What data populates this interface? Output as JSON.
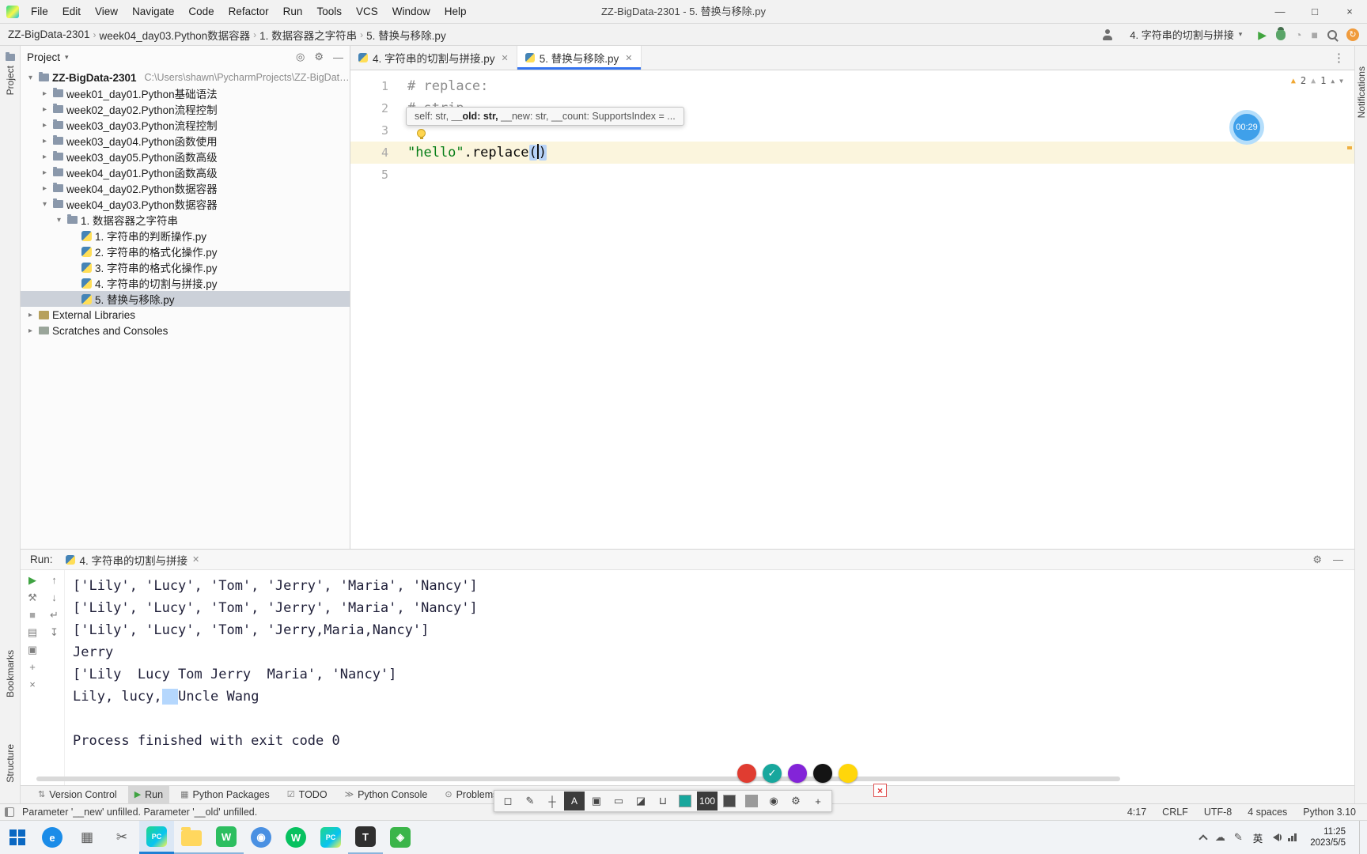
{
  "icons": {
    "minimize": "—",
    "maximize": "□",
    "close": "×",
    "combo_caret": "▾",
    "play": "▶",
    "profiler": "◔",
    "stop": "■",
    "update": "↻",
    "target": "◎",
    "gear": "⚙",
    "hide": "—",
    "more": "⋮",
    "warning_triangle": "▲",
    "up": "▲",
    "down": "▼",
    "close_small": "✕"
  },
  "titlebar": {
    "menus": [
      "File",
      "Edit",
      "View",
      "Navigate",
      "Code",
      "Refactor",
      "Run",
      "Tools",
      "VCS",
      "Window",
      "Help"
    ],
    "title": "ZZ-BigData-2301 - 5. 替换与移除.py"
  },
  "navbar": {
    "breadcrumbs": [
      "ZZ-BigData-2301",
      "week04_day03.Python数据容器",
      "1. 数据容器之字符串",
      "5. 替换与移除.py"
    ],
    "separator": "›",
    "run_config": "4. 字符串的切割与拼接"
  },
  "stripes": {
    "left_top": "Project",
    "left_bottom": [
      "Bookmarks",
      "Structure"
    ],
    "right_top": "Notifications"
  },
  "project_panel": {
    "title": "Project",
    "tree": [
      {
        "label": "ZZ-BigData-2301",
        "hint": "C:\\Users\\shawn\\PycharmProjects\\ZZ-BigData-2...",
        "depth": 0,
        "type": "folder",
        "arrow": "expanded",
        "bold": true
      },
      {
        "label": "week01_day01.Python基础语法",
        "depth": 1,
        "type": "folder",
        "arrow": "collapsed"
      },
      {
        "label": "week02_day02.Python流程控制",
        "depth": 1,
        "type": "folder",
        "arrow": "collapsed"
      },
      {
        "label": "week03_day03.Python流程控制",
        "depth": 1,
        "type": "folder",
        "arrow": "collapsed"
      },
      {
        "label": "week03_day04.Python函数使用",
        "depth": 1,
        "type": "folder",
        "arrow": "collapsed"
      },
      {
        "label": "week03_day05.Python函数高级",
        "depth": 1,
        "type": "folder",
        "arrow": "collapsed"
      },
      {
        "label": "week04_day01.Python函数高级",
        "depth": 1,
        "type": "folder",
        "arrow": "collapsed"
      },
      {
        "label": "week04_day02.Python数据容器",
        "depth": 1,
        "type": "folder",
        "arrow": "collapsed"
      },
      {
        "label": "week04_day03.Python数据容器",
        "depth": 1,
        "type": "folder",
        "arrow": "expanded"
      },
      {
        "label": "1. 数据容器之字符串",
        "depth": 2,
        "type": "folder",
        "arrow": "expanded"
      },
      {
        "label": "1. 字符串的判断操作.py",
        "depth": 3,
        "type": "pyfile"
      },
      {
        "label": "2. 字符串的格式化操作.py",
        "depth": 3,
        "type": "pyfile"
      },
      {
        "label": "3. 字符串的格式化操作.py",
        "depth": 3,
        "type": "pyfile"
      },
      {
        "label": "4. 字符串的切割与拼接.py",
        "depth": 3,
        "type": "pyfile"
      },
      {
        "label": "5. 替换与移除.py",
        "depth": 3,
        "type": "pyfile",
        "selected": true
      },
      {
        "label": "External Libraries",
        "depth": 0,
        "type": "lib",
        "arrow": "collapsed"
      },
      {
        "label": "Scratches and Consoles",
        "depth": 0,
        "type": "scratch",
        "arrow": "collapsed"
      }
    ]
  },
  "editor": {
    "tabs": [
      {
        "label": "4. 字符串的切割与拼接.py",
        "active": false
      },
      {
        "label": "5. 替换与移除.py",
        "active": true
      }
    ],
    "inspections": {
      "warnings": "2",
      "weak_warnings": "1"
    },
    "lines": [
      {
        "num": "1",
        "segments": [
          {
            "text": "# replace:",
            "style": "comment"
          }
        ]
      },
      {
        "num": "2",
        "segments": [
          {
            "text": "# strip",
            "style": "comment"
          }
        ]
      },
      {
        "num": "3",
        "segments": []
      },
      {
        "num": "4",
        "current": true,
        "segments": [
          {
            "text": "\"hello\"",
            "style": "string"
          },
          {
            "text": ".replace",
            "style": "plain"
          },
          {
            "text": "(",
            "style": "paren"
          },
          {
            "caret": true
          },
          {
            "text": ")",
            "style": "paren"
          }
        ]
      },
      {
        "num": "5",
        "segments": []
      }
    ],
    "param_hint": [
      {
        "text": "self: str, ",
        "bold": false
      },
      {
        "text": "__old: str, ",
        "bold": true
      },
      {
        "text": "__new: str, __count: SupportsIndex = ...",
        "bold": false
      }
    ],
    "timer": "00:29"
  },
  "run_panel": {
    "label": "Run:",
    "tab": "4. 字符串的切割与拼接",
    "toolbar_left": [
      {
        "name": "rerun-icon",
        "glyph": "▶",
        "color": "#3fa342"
      },
      {
        "name": "build-icon",
        "glyph": "⚒",
        "color": "#7f7f7f"
      },
      {
        "name": "stop-icon",
        "glyph": "■",
        "color": "#a8a8a8"
      },
      {
        "name": "restore-layout-icon",
        "glyph": "▤",
        "color": "#7f7f7f"
      },
      {
        "name": "print-icon",
        "glyph": "▣",
        "color": "#7f7f7f"
      },
      {
        "name": "pin-icon",
        "glyph": "+",
        "color": "#7f7f7f"
      },
      {
        "name": "clear-icon",
        "glyph": "×",
        "color": "#7f7f7f"
      }
    ],
    "toolbar_inner": [
      {
        "name": "prev-stack-icon",
        "glyph": "↑",
        "color": "#7f7f7f"
      },
      {
        "name": "next-stack-icon",
        "glyph": "↓",
        "color": "#7f7f7f"
      },
      {
        "name": "softwrap-icon",
        "glyph": "↵",
        "color": "#7f7f7f"
      },
      {
        "name": "scroll-end-icon",
        "glyph": "↧",
        "color": "#7f7f7f"
      }
    ],
    "console": [
      [
        {
          "text": "['Lily', 'Lucy', 'Tom', 'Jerry', 'Maria', 'Nancy']"
        }
      ],
      [
        {
          "text": "['Lily', 'Lucy', 'Tom', 'Jerry', 'Maria', 'Nancy']"
        }
      ],
      [
        {
          "text": "['Lily', 'Lucy', 'Tom', 'Jerry,Maria,Nancy']"
        }
      ],
      [
        {
          "text": "Jerry"
        }
      ],
      [
        {
          "text": "['Lily  Lucy Tom Jerry  Maria', 'Nancy']"
        }
      ],
      [
        {
          "text": "Lily, lucy,"
        },
        {
          "text": "  ",
          "selected": true
        },
        {
          "text": "Uncle Wang"
        }
      ],
      [],
      [
        {
          "text": "Process finished with exit code 0"
        }
      ]
    ]
  },
  "tool_tabs": [
    {
      "label": "Version Control",
      "icon": "⇅"
    },
    {
      "label": "Run",
      "icon": "▶",
      "icon_color": "#3fa342",
      "active": true
    },
    {
      "label": "Python Packages",
      "icon": "▦"
    },
    {
      "label": "TODO",
      "icon": "☑"
    },
    {
      "label": "Python Console",
      "icon": "≫"
    },
    {
      "label": "Problems",
      "icon": "⊙"
    }
  ],
  "statusbar": {
    "message": "Parameter '__new' unfilled. Parameter '__old' unfilled.",
    "items": [
      "4:17",
      "CRLF",
      "UTF-8",
      "4 spaces",
      "Python 3.10"
    ]
  },
  "taskbar": {
    "language": "英",
    "clock_time": "11:25",
    "clock_date": "2023/5/5",
    "apps": [
      {
        "name": "edge-browser",
        "glyph": "e",
        "bg": "#1b8ce8",
        "fg": "#ffffff",
        "shape": "circle"
      },
      {
        "name": "task-view",
        "glyph": "▦",
        "fg": "#5a5a5a",
        "shape": "plain"
      },
      {
        "name": "snipping-tool",
        "glyph": "✂",
        "fg": "#5a5a5a",
        "shape": "plain"
      },
      {
        "name": "pycharm",
        "glyph": "PC",
        "shape": "pycharm",
        "active": true
      },
      {
        "name": "file-explorer",
        "glyph": "",
        "shape": "folder",
        "running": true
      },
      {
        "name": "wechat",
        "glyph": "W",
        "bg": "#2dbe60",
        "fg": "#ffffff",
        "running": true
      },
      {
        "name": "chrome",
        "glyph": "◉",
        "bg": "#4a90e2",
        "fg": "#ffffff",
        "shape": "circle"
      },
      {
        "name": "weixin-files",
        "glyph": "W",
        "bg": "#07c160",
        "fg": "#ffffff",
        "shape": "circle"
      },
      {
        "name": "pycharm-community",
        "glyph": "PC",
        "shape": "pycharm"
      },
      {
        "name": "typora",
        "glyph": "T",
        "bg": "#2f2f2f",
        "fg": "#ffffff",
        "running": true
      },
      {
        "name": "green-app",
        "glyph": "◈",
        "bg": "#3bb54a",
        "fg": "#ffffff"
      }
    ]
  },
  "annotation": {
    "palette": [
      {
        "name": "color-red",
        "color": "#e03c31"
      },
      {
        "name": "color-teal-selected",
        "color": "#18a79d",
        "check": "✓"
      },
      {
        "name": "color-purple",
        "color": "#8324d8"
      },
      {
        "name": "color-black",
        "color": "#141414"
      },
      {
        "name": "color-yellow",
        "color": "#ffd60a"
      }
    ],
    "tools": [
      {
        "name": "select-tool",
        "glyph": "◻"
      },
      {
        "name": "pen-tool",
        "glyph": "✎"
      },
      {
        "name": "crop-tool",
        "glyph": "┼"
      },
      {
        "name": "text-tool",
        "glyph": "A",
        "dark": true
      },
      {
        "name": "image-tool",
        "glyph": "▣"
      },
      {
        "name": "rect-tool",
        "glyph": "▭"
      },
      {
        "name": "eraser-tool",
        "glyph": "◪"
      },
      {
        "name": "trash-tool",
        "glyph": "⊔"
      },
      {
        "name": "color-swatch",
        "swatch": "#18a79d"
      },
      {
        "name": "opacity-value",
        "glyph": "100",
        "dark": true
      },
      {
        "name": "swatch-dark",
        "swatch": "#4a4a4a"
      },
      {
        "name": "swatch-gray",
        "swatch": "#9a9a9a"
      },
      {
        "name": "visibility-tool",
        "glyph": "◉"
      },
      {
        "name": "settings-tool",
        "glyph": "⚙"
      },
      {
        "name": "move-tool",
        "glyph": "+"
      }
    ],
    "close_glyph": "×"
  }
}
